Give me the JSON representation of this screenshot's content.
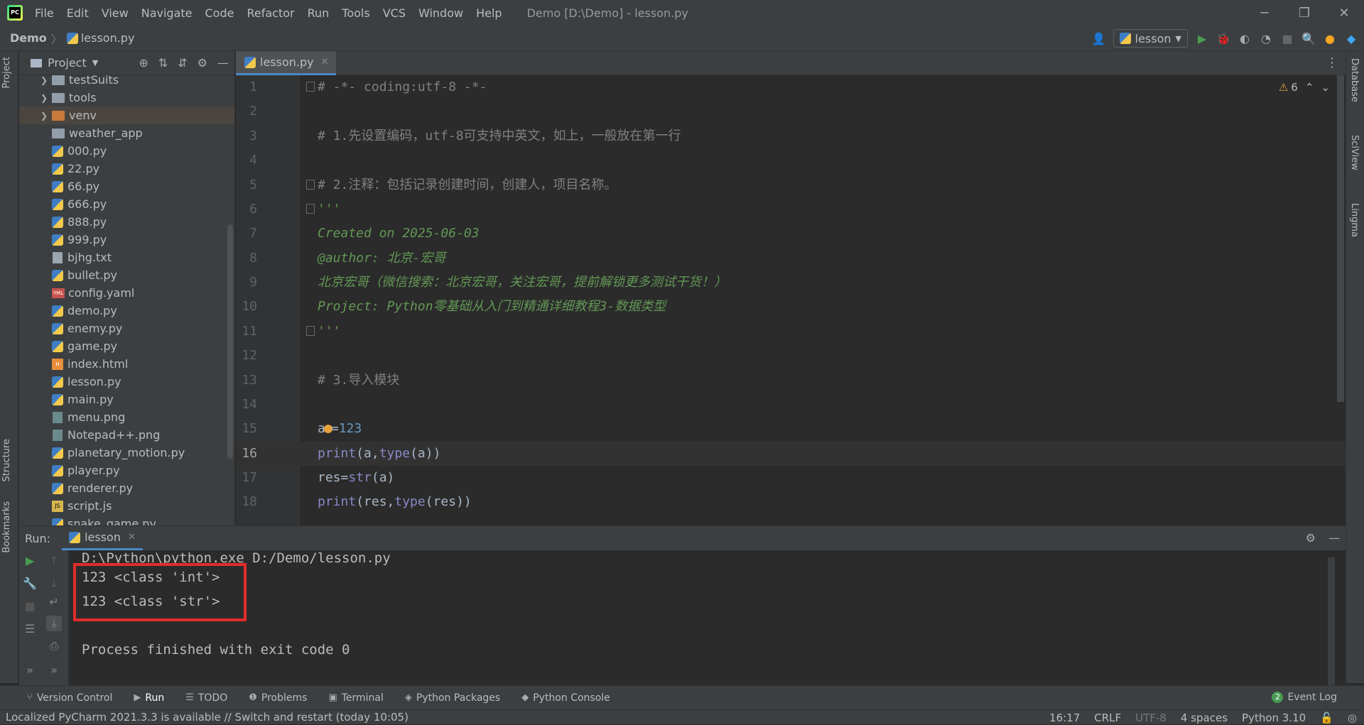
{
  "app": {
    "window_title": "Demo [D:\\Demo] - lesson.py",
    "menu": [
      "File",
      "Edit",
      "View",
      "Navigate",
      "Code",
      "Refactor",
      "Run",
      "Tools",
      "VCS",
      "Window",
      "Help"
    ]
  },
  "breadcrumb": {
    "root": "Demo",
    "file": "lesson.py"
  },
  "toolbar": {
    "run_config": "lesson"
  },
  "side_tabs": {
    "left": [
      "Project",
      "Structure",
      "Bookmarks"
    ],
    "right": [
      "Database",
      "SciView",
      "Lingma"
    ]
  },
  "project": {
    "title": "Project",
    "tree": [
      {
        "name": "testSuits",
        "kind": "folder",
        "expandable": true
      },
      {
        "name": "tools",
        "kind": "folder",
        "expandable": true
      },
      {
        "name": "venv",
        "kind": "folder-orange",
        "expandable": true,
        "selected": true
      },
      {
        "name": "weather_app",
        "kind": "folder",
        "expandable": false
      },
      {
        "name": "000.py",
        "kind": "py"
      },
      {
        "name": "22.py",
        "kind": "py"
      },
      {
        "name": "66.py",
        "kind": "py"
      },
      {
        "name": "666.py",
        "kind": "py"
      },
      {
        "name": "888.py",
        "kind": "py"
      },
      {
        "name": "999.py",
        "kind": "py"
      },
      {
        "name": "bjhg.txt",
        "kind": "txt"
      },
      {
        "name": "bullet.py",
        "kind": "py"
      },
      {
        "name": "config.yaml",
        "kind": "yaml"
      },
      {
        "name": "demo.py",
        "kind": "py"
      },
      {
        "name": "enemy.py",
        "kind": "py"
      },
      {
        "name": "game.py",
        "kind": "py"
      },
      {
        "name": "index.html",
        "kind": "html"
      },
      {
        "name": "lesson.py",
        "kind": "py"
      },
      {
        "name": "main.py",
        "kind": "py"
      },
      {
        "name": "menu.png",
        "kind": "img"
      },
      {
        "name": "Notepad++.png",
        "kind": "img"
      },
      {
        "name": "planetary_motion.py",
        "kind": "py"
      },
      {
        "name": "player.py",
        "kind": "py"
      },
      {
        "name": "renderer.py",
        "kind": "py"
      },
      {
        "name": "script.js",
        "kind": "js"
      },
      {
        "name": "snake_game.py",
        "kind": "py"
      }
    ]
  },
  "editor": {
    "tab_label": "lesson.py",
    "warnings": "6",
    "current_line": 16,
    "lines": [
      {
        "n": "1",
        "fold": true,
        "segs": [
          {
            "t": "# -*- coding:utf-8 -*-",
            "c": "c-comment"
          }
        ]
      },
      {
        "n": "2",
        "segs": []
      },
      {
        "n": "3",
        "segs": [
          {
            "t": "# 1.先设置编码，utf-8可支持中英文，如上，一般放在第一行",
            "c": "c-comment"
          }
        ]
      },
      {
        "n": "4",
        "segs": []
      },
      {
        "n": "5",
        "fold": true,
        "segs": [
          {
            "t": "# 2.注释：包括记录创建时间，创建人，项目名称。",
            "c": "c-comment"
          }
        ]
      },
      {
        "n": "6",
        "fold": true,
        "segs": [
          {
            "t": "'''",
            "c": "c-doc"
          }
        ]
      },
      {
        "n": "7",
        "segs": [
          {
            "t": "Created on 2025-06-03",
            "c": "c-doc"
          }
        ]
      },
      {
        "n": "8",
        "segs": [
          {
            "t": "@author: 北京-宏哥",
            "c": "c-doc"
          }
        ]
      },
      {
        "n": "9",
        "segs": [
          {
            "t": "北京宏哥（微信搜索：北京宏哥，关注宏哥，提前解锁更多测试干货！）",
            "c": "c-doc"
          }
        ]
      },
      {
        "n": "10",
        "segs": [
          {
            "t": "Project: Python零基础从入门到精通详细教程3-数据类型",
            "c": "c-doc"
          }
        ]
      },
      {
        "n": "11",
        "fold": true,
        "segs": [
          {
            "t": "'''",
            "c": "c-doc"
          }
        ]
      },
      {
        "n": "12",
        "segs": []
      },
      {
        "n": "13",
        "segs": [
          {
            "t": "# 3.导入模块",
            "c": "c-comment"
          }
        ]
      },
      {
        "n": "14",
        "segs": []
      },
      {
        "n": "15",
        "bulb": true,
        "segs": [
          {
            "t": "a",
            "c": "c-plain"
          },
          {
            "t": "=",
            "c": "c-plain"
          },
          {
            "t": "123",
            "c": "c-num"
          }
        ]
      },
      {
        "n": "16",
        "segs": [
          {
            "t": "print",
            "c": "c-builtin"
          },
          {
            "t": "(a,",
            "c": "c-plain"
          },
          {
            "t": "type",
            "c": "c-builtin"
          },
          {
            "t": "(a))",
            "c": "c-plain"
          }
        ]
      },
      {
        "n": "17",
        "segs": [
          {
            "t": "res=",
            "c": "c-plain"
          },
          {
            "t": "str",
            "c": "c-builtin"
          },
          {
            "t": "(a)",
            "c": "c-plain"
          }
        ]
      },
      {
        "n": "18",
        "segs": [
          {
            "t": "print",
            "c": "c-builtin"
          },
          {
            "t": "(res,",
            "c": "c-plain"
          },
          {
            "t": "type",
            "c": "c-builtin"
          },
          {
            "t": "(res))",
            "c": "c-plain"
          }
        ]
      }
    ]
  },
  "run": {
    "label": "Run:",
    "tab": "lesson",
    "console": [
      "D:\\Python\\python.exe D:/Demo/lesson.py",
      "123 <class 'int'>",
      "123 <class 'str'>",
      "",
      "Process finished with exit code 0"
    ]
  },
  "bottom_tabs": [
    "Version Control",
    "Run",
    "TODO",
    "Problems",
    "Terminal",
    "Python Packages",
    "Python Console"
  ],
  "event_log": {
    "label": "Event Log",
    "count": "2"
  },
  "status": {
    "message": "Localized PyCharm 2021.3.3 is available // Switch and restart (today 10:05)",
    "position": "16:17",
    "line_sep": "CRLF",
    "encoding": "UTF-8",
    "indent": "4 spaces",
    "interpreter": "Python 3.10"
  }
}
